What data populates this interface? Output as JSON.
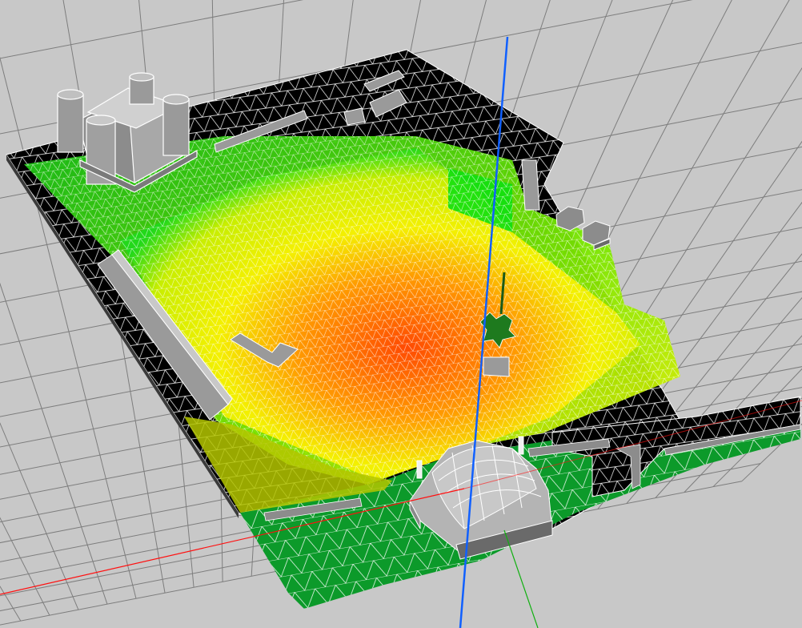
{
  "viewport": {
    "background": "#c8c8c8",
    "grid_color": "#8a8a8a",
    "grid_line_color": "#7d7d7d"
  },
  "heatmap": {
    "colors": {
      "outside": "#000000",
      "ground": "#0c9a2a",
      "low": "#22e01a",
      "mid": "#f2f200",
      "high": "#ff8a00",
      "peak": "#ff4a00"
    },
    "mesh_color": "#ffffff"
  },
  "axes": {
    "x_color": "#ff1010",
    "y_color": "#10b010",
    "z_color": "#1060ff"
  },
  "objects": [
    {
      "name": "castle",
      "icon": "castle-icon"
    },
    {
      "name": "dome-building",
      "icon": "dome-icon"
    },
    {
      "name": "tree",
      "icon": "tree-icon"
    },
    {
      "name": "gazebo",
      "icon": "gazebo-icon"
    }
  ]
}
